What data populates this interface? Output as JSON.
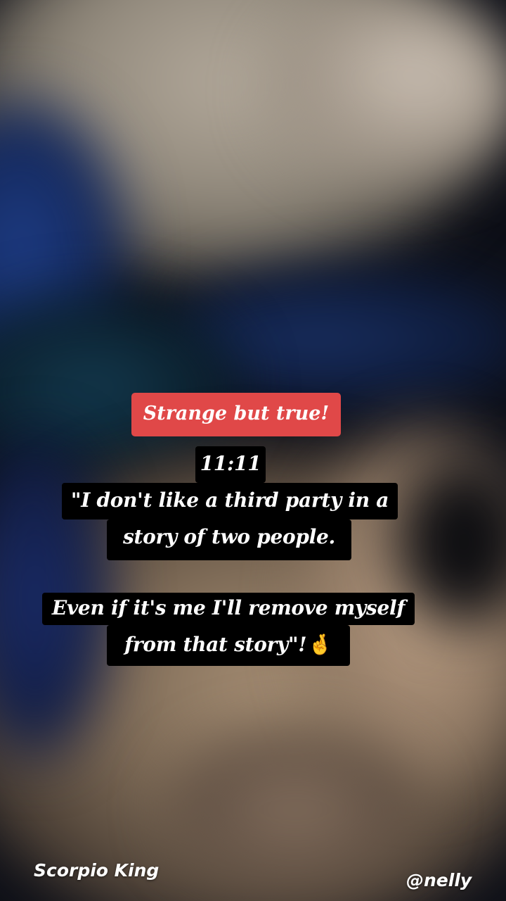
{
  "story": {
    "header_tag": "Strange but true!",
    "lines": [
      "11:11",
      "\"I don't like a third party in a",
      "story of two people.",
      "Even if it's me I'll remove myself",
      "from that story\"!"
    ],
    "emoji": "🤞"
  },
  "watermarks": {
    "brand": "Scorpio King",
    "handle": "@nelly"
  },
  "colors": {
    "header_tag_bg": "#e04848",
    "caption_bg": "#000000",
    "text": "#ffffff"
  },
  "icons": {
    "emoji": "fingers-crossed-icon"
  }
}
